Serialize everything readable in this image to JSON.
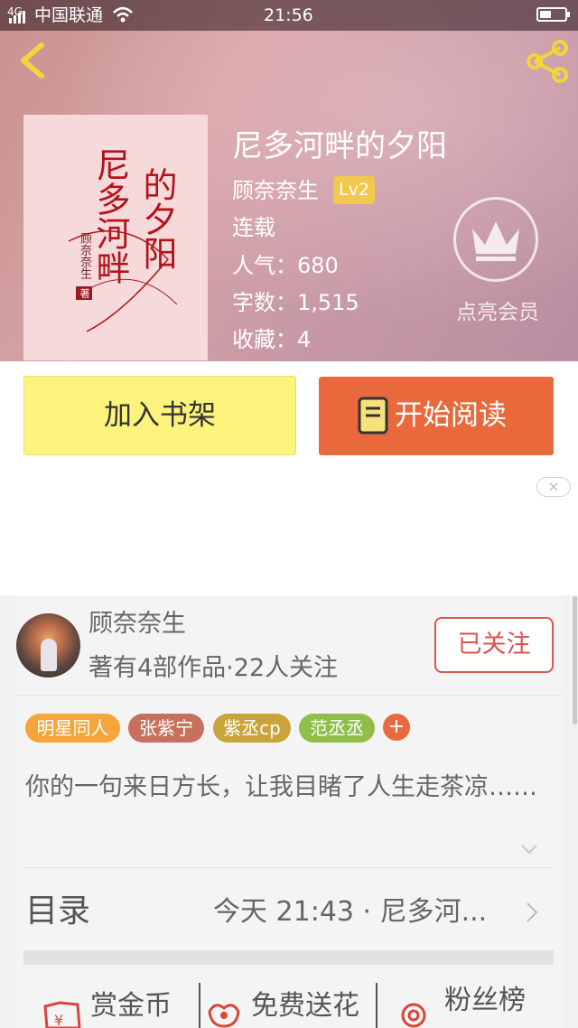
{
  "status_bar": {
    "carrier": "中国联通",
    "signal_label": "4G",
    "time": "21:56"
  },
  "book": {
    "title": "尼多河畔的夕阳",
    "author": "顾奈奈生",
    "level": "Lv2",
    "status": "连载",
    "popularity": "人气：680",
    "word_count": "字数：1,515",
    "favorites": "收藏：4",
    "cover": {
      "title_col1": "尼多河畔",
      "title_col2": "的夕阳",
      "author": "顾奈奈生",
      "stamp": "著"
    }
  },
  "vip": {
    "label": "点亮会员"
  },
  "actions": {
    "add_shelf": "加入书架",
    "start_read": "开始阅读"
  },
  "ad": {
    "close_glyph": "×"
  },
  "author_card": {
    "name": "顾奈奈生",
    "meta": "著有4部作品·22人关注",
    "follow_label": "已关注"
  },
  "tags": [
    {
      "label": "明星同人",
      "color": "#f5a53a"
    },
    {
      "label": "张紫宁",
      "color": "#c8705e"
    },
    {
      "label": "紫丞cp",
      "color": "#c9a43b"
    },
    {
      "label": "范丞丞",
      "color": "#8fbf4a"
    }
  ],
  "tag_plus": "+",
  "intro": "你的一句来日方长，让我目睹了人生走茶凉……",
  "catalog": {
    "label": "目录",
    "latest": "今天 21:43 · 尼多河..."
  },
  "bottom": {
    "reward": "赏金币",
    "flower": "免费送花",
    "fans": "粉丝榜"
  },
  "colors": {
    "accent_orange": "#e9693c",
    "shelf_yellow": "#fbf37c",
    "follow_red": "#d9534f",
    "level_badge": "#f2c94c"
  }
}
